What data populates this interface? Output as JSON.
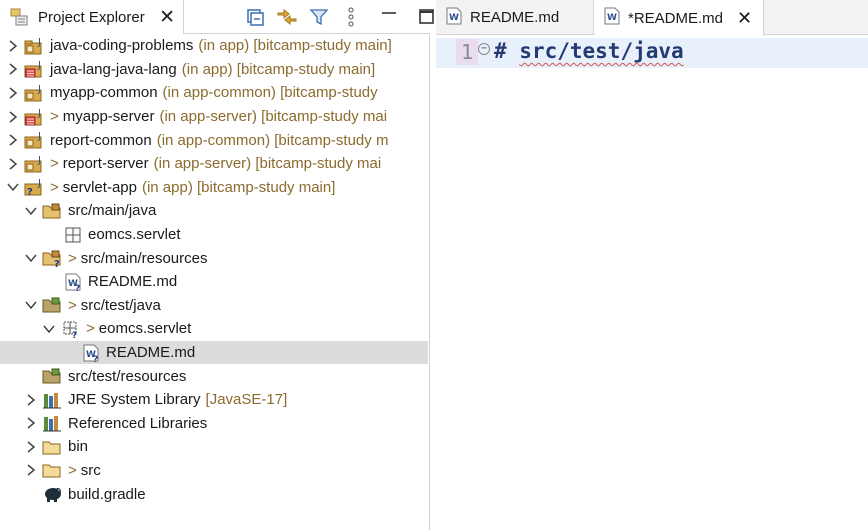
{
  "explorer": {
    "title": "Project Explorer",
    "close": "✕"
  },
  "tree": [
    {
      "label": "java-coding-problems",
      "deco": "(in app) [bitcamp-study main]",
      "gt": ""
    },
    {
      "label": "java-lang-java-lang",
      "deco": "(in app) [bitcamp-study main]",
      "gt": ""
    },
    {
      "label": "myapp-common",
      "deco": "(in app-common) [bitcamp-study",
      "gt": ""
    },
    {
      "label": "myapp-server",
      "deco": "(in app-server) [bitcamp-study mai",
      "gt": ">"
    },
    {
      "label": "report-common",
      "deco": "(in app-common) [bitcamp-study m",
      "gt": ""
    },
    {
      "label": "report-server",
      "deco": "(in app-server) [bitcamp-study mai",
      "gt": ">"
    },
    {
      "label": "servlet-app",
      "deco": "(in app) [bitcamp-study main]",
      "gt": ">"
    },
    {
      "label": "src/main/java",
      "deco": "",
      "gt": ""
    },
    {
      "label": "eomcs.servlet",
      "deco": "",
      "gt": ""
    },
    {
      "label": "src/main/resources",
      "deco": "",
      "gt": ">"
    },
    {
      "label": "README.md",
      "deco": "",
      "gt": ""
    },
    {
      "label": "src/test/java",
      "deco": "",
      "gt": ">"
    },
    {
      "label": "eomcs.servlet",
      "deco": "",
      "gt": ">"
    },
    {
      "label": "README.md",
      "deco": "",
      "gt": ""
    },
    {
      "label": "src/test/resources",
      "deco": "",
      "gt": ""
    },
    {
      "label": "JRE System Library",
      "deco": "[JavaSE-17]",
      "gt": ""
    },
    {
      "label": "Referenced Libraries",
      "deco": "",
      "gt": ""
    },
    {
      "label": "bin",
      "deco": "",
      "gt": ""
    },
    {
      "label": "src",
      "deco": "",
      "gt": ">"
    },
    {
      "label": "build.gradle",
      "deco": "",
      "gt": ""
    }
  ],
  "editor": {
    "tabs": [
      {
        "label": "README.md"
      },
      {
        "label": "*README.md",
        "close": "✕"
      }
    ],
    "line_number": "1",
    "code_hash": "# ",
    "code_text": "src/test/java"
  }
}
